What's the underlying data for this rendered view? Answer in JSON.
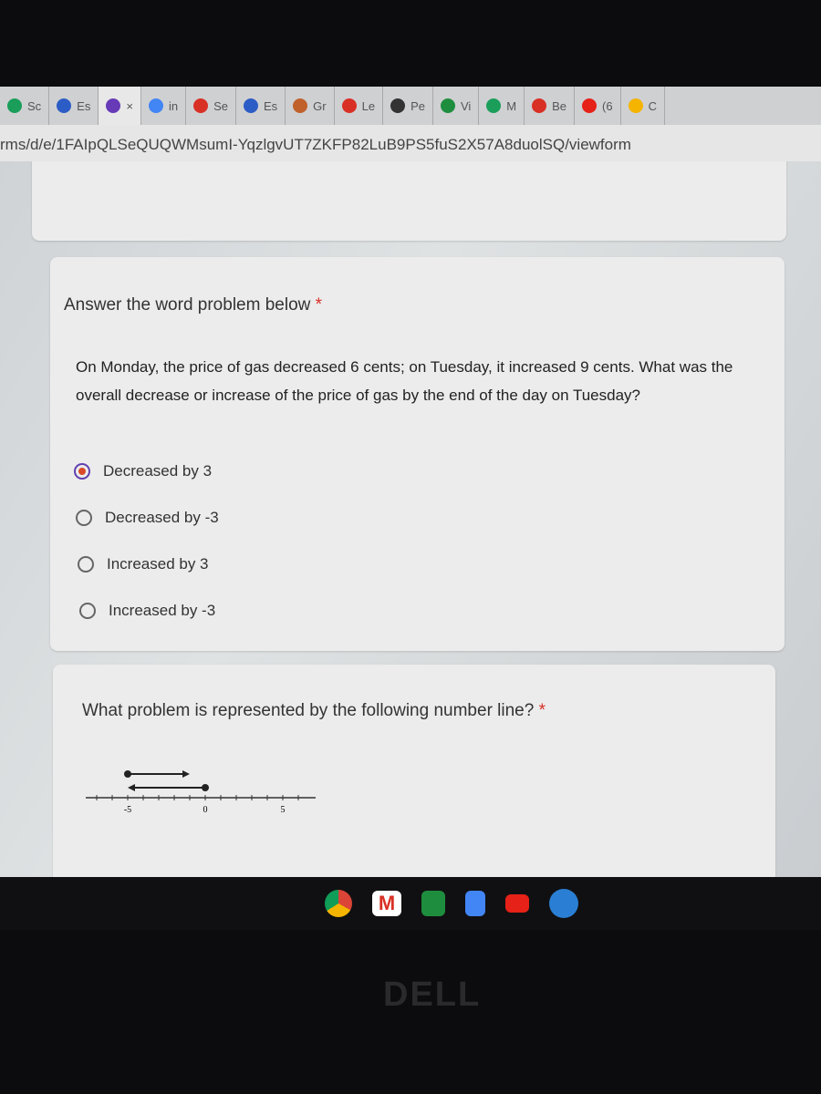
{
  "browser": {
    "tabs": [
      {
        "label": "Sc",
        "icon": "chat-icon",
        "color": "#1a9e5a"
      },
      {
        "label": "Es",
        "icon": "k-icon",
        "color": "#2c5cc5"
      },
      {
        "label": "×",
        "icon": "forms-icon",
        "color": "#673ab7",
        "active": true
      },
      {
        "label": "in",
        "icon": "google-icon",
        "color": "#4285f4"
      },
      {
        "label": "Se",
        "icon": "clapper-icon",
        "color": "#d93025"
      },
      {
        "label": "Es",
        "icon": "k-icon",
        "color": "#2c5cc5"
      },
      {
        "label": "Gr",
        "icon": "avatar-icon",
        "color": "#c0612b"
      },
      {
        "label": "Le",
        "icon": "gmail-icon",
        "color": "#d93025"
      },
      {
        "label": "Pe",
        "icon": "contact-icon",
        "color": "#333333"
      },
      {
        "label": "Vi",
        "icon": "plus-icon",
        "color": "#1e8e3e"
      },
      {
        "label": "M",
        "icon": "chat-icon",
        "color": "#1a9e5a"
      },
      {
        "label": "Be",
        "icon": "pin-icon",
        "color": "#d93025"
      },
      {
        "label": "(6",
        "icon": "youtube-icon",
        "color": "#e62117"
      },
      {
        "label": "C",
        "icon": "drive-icon",
        "color": "#f4b400"
      }
    ],
    "url": "rms/d/e/1FAIpQLSeQUQWMsumI-YqzlgvUT7ZKFP82LuB9PS5fuS2X57A8duolSQ/viewform"
  },
  "form": {
    "q1": {
      "title": "Answer the word problem below",
      "required": "*",
      "problem": "On Monday, the price of gas decreased 6 cents; on Tuesday, it increased 9 cents. What was the overall decrease or increase of the price of gas by the end of the day on Tuesday?",
      "options": [
        "Decreased by 3",
        "Decreased by -3",
        "Increased by 3",
        "Increased by -3"
      ],
      "selected": 0
    },
    "q2": {
      "title": "What problem is represented by the following number line?",
      "required": "*",
      "number_line": {
        "labels": [
          "-5",
          "0",
          "5"
        ],
        "range": [
          -7,
          6
        ]
      }
    }
  },
  "taskbar": {
    "apps": [
      "chrome",
      "gmail",
      "classroom",
      "docs",
      "youtube",
      "meet"
    ]
  },
  "bezel": {
    "logo": "DELL"
  }
}
